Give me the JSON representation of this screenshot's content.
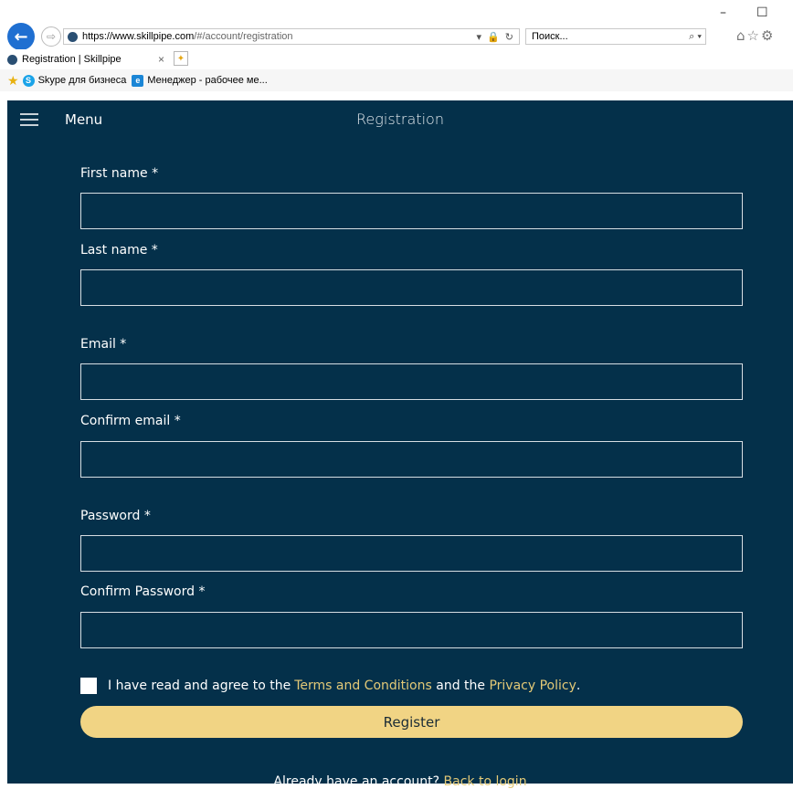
{
  "browser": {
    "url_scheme": "https://www.",
    "url_host": "skillpipe.com",
    "url_path": "/#/account/registration",
    "search_placeholder": "Поиск...",
    "tab_title": "Registration | Skillpipe",
    "tab_close": "×",
    "favorites": [
      {
        "label": "Skype для бизнеса",
        "icon": "skype-icon"
      },
      {
        "label": "Менеджер - рабочее ме...",
        "icon": "ie-icon"
      }
    ],
    "window_controls": {
      "minimize": "–",
      "maximize": "☐"
    }
  },
  "app": {
    "menu_label": "Menu",
    "page_title": "Registration",
    "fields": [
      {
        "label": "First name *",
        "value": "",
        "placeholder": ""
      },
      {
        "label": "Last name *",
        "value": "",
        "placeholder": ""
      },
      {
        "label": "Email *",
        "value": "",
        "placeholder": ""
      },
      {
        "label": "Confirm email *",
        "value": "",
        "placeholder": ""
      },
      {
        "label": "Password *",
        "value": "",
        "placeholder": ""
      },
      {
        "label": "Confirm Password *",
        "value": "",
        "placeholder": ""
      }
    ],
    "agree": {
      "text_1": "I have read and agree to the ",
      "terms_link": "Terms and Conditions",
      "text_2": " and the ",
      "privacy_link": "Privacy Policy",
      "text_3": "."
    },
    "register_label": "Register",
    "login_prompt": "Already have an account? ",
    "login_link": "Back to login"
  },
  "colors": {
    "background": "#04304a",
    "accent": "#f1d484",
    "link": "#e3c977"
  }
}
